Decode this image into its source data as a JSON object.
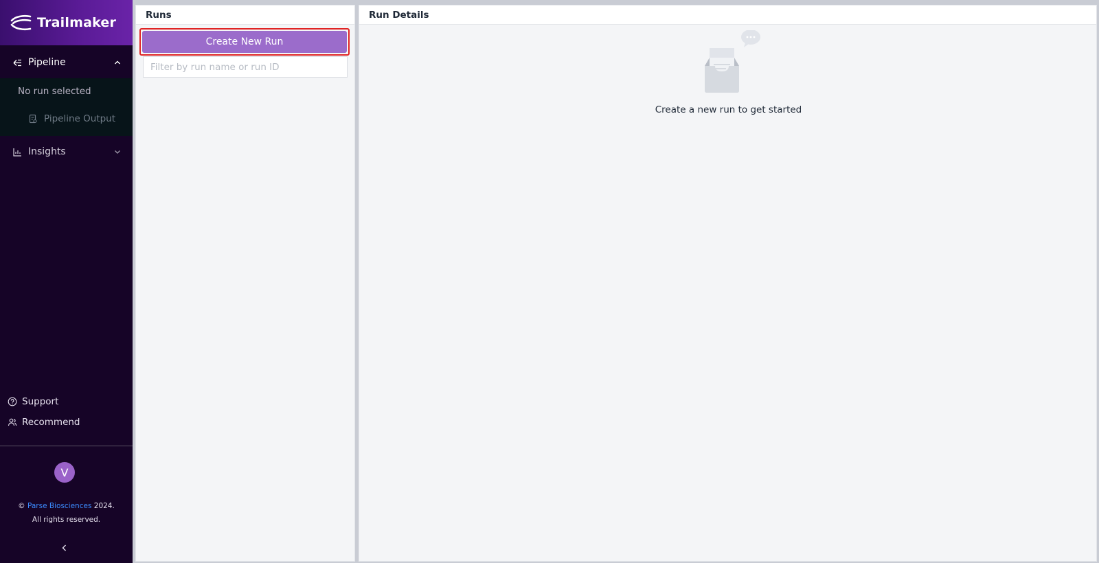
{
  "brand": {
    "name": "Trailmaker"
  },
  "sidebar": {
    "pipeline": {
      "label": "Pipeline",
      "expanded": true
    },
    "no_run_selected": "No run selected",
    "pipeline_output": "Pipeline Output",
    "insights": {
      "label": "Insights",
      "expanded": false
    },
    "support": "Support",
    "recommend": "Recommend",
    "avatar_initial": "V",
    "copyright": {
      "symbol": "©",
      "company": "Parse Biosciences",
      "year": "2024.",
      "rights": "All rights reserved."
    }
  },
  "runs_panel": {
    "title": "Runs",
    "create_button": "Create New Run",
    "filter_placeholder": "Filter by run name or run ID"
  },
  "details_panel": {
    "title": "Run Details",
    "empty_message": "Create a new run to get started"
  },
  "colors": {
    "sidebar_bg": "#160427",
    "brand_gradient_end": "#6a23a8",
    "primary_button": "#9b6ccb",
    "highlight_border": "#e02424",
    "link": "#3b8cff",
    "avatar": "#9a62c9"
  }
}
